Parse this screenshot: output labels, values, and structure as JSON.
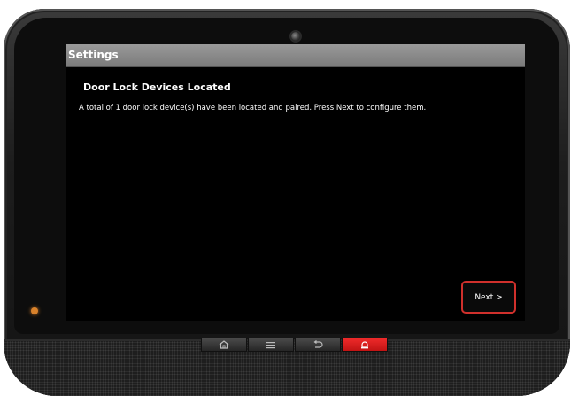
{
  "header": {
    "title": "Settings"
  },
  "main": {
    "heading": "Door Lock Devices Located",
    "message": "A total of 1 door lock device(s) have been located and paired.  Press Next to configure them."
  },
  "actions": {
    "next_label": "Next >"
  },
  "hardware_buttons": [
    {
      "name": "home",
      "icon": "home-icon"
    },
    {
      "name": "menu",
      "icon": "menu-icon"
    },
    {
      "name": "back",
      "icon": "back-icon"
    },
    {
      "name": "alarm",
      "icon": "alarm-icon"
    }
  ],
  "colors": {
    "next_border": "#d0302c",
    "alarm_button": "#e02020",
    "status_led": "#d9822b",
    "titlebar": "#8a8a8a"
  }
}
